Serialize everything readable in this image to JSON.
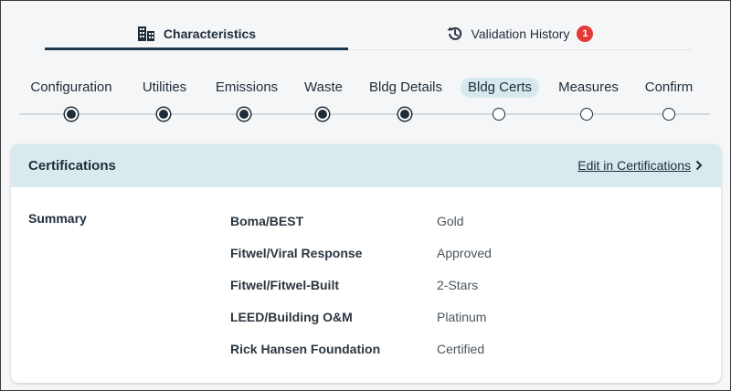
{
  "tabs": {
    "characteristics": {
      "label": "Characteristics",
      "icon": "building-icon"
    },
    "validation": {
      "label": "Validation History",
      "icon": "history-icon",
      "badge": "1"
    }
  },
  "stepper": {
    "steps": [
      {
        "label": "Configuration",
        "status": "complete"
      },
      {
        "label": "Utilities",
        "status": "complete"
      },
      {
        "label": "Emissions",
        "status": "complete"
      },
      {
        "label": "Waste",
        "status": "complete"
      },
      {
        "label": "Bldg Details",
        "status": "complete"
      },
      {
        "label": "Bldg Certs",
        "status": "current"
      },
      {
        "label": "Measures",
        "status": "pending"
      },
      {
        "label": "Confirm",
        "status": "pending"
      }
    ]
  },
  "certifications": {
    "title": "Certifications",
    "edit_link": "Edit in Certifications",
    "summary_label": "Summary",
    "rows": [
      {
        "name": "Boma/BEST",
        "value": "Gold"
      },
      {
        "name": "Fitwel/Viral Response",
        "value": "Approved"
      },
      {
        "name": "Fitwel/Fitwel-Built",
        "value": "2-Stars"
      },
      {
        "name": "LEED/Building O&M",
        "value": "Platinum"
      },
      {
        "name": "Rick Hansen Foundation",
        "value": "Certified"
      }
    ]
  },
  "colors": {
    "accent": "#1e3a52",
    "header_bg": "#d9eaee",
    "badge": "#e53935"
  }
}
